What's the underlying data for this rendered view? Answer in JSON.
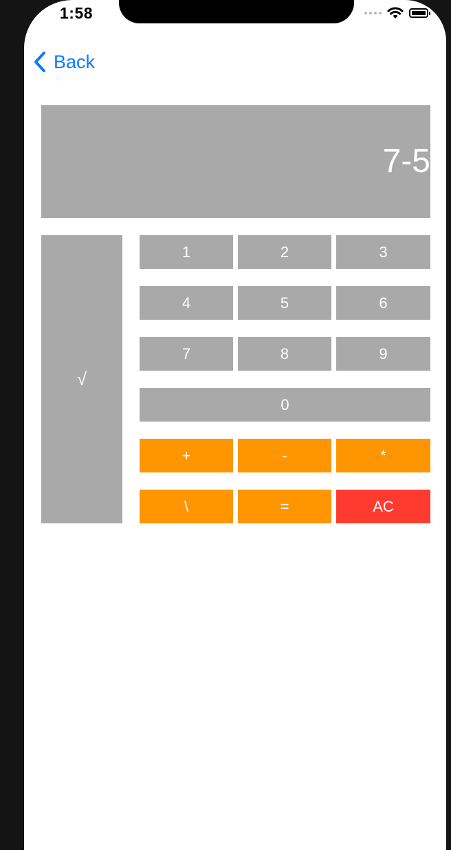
{
  "status_bar": {
    "time": "1:58"
  },
  "nav": {
    "back_label": "Back"
  },
  "display": {
    "expression": "7-5"
  },
  "keys": {
    "sqrt": "√",
    "one": "1",
    "two": "2",
    "three": "3",
    "four": "4",
    "five": "5",
    "six": "6",
    "seven": "7",
    "eight": "8",
    "nine": "9",
    "zero": "0",
    "plus": "+",
    "minus": "-",
    "multiply": "*",
    "divide": "\\",
    "equals": "=",
    "clear": "AC"
  },
  "colors": {
    "key_gray": "#a9a9a9",
    "operator_orange": "#ff9500",
    "clear_red": "#ff3b30",
    "link_blue": "#0a7aff"
  },
  "icons": {
    "back": "chevron-left-icon",
    "wifi": "wifi-icon",
    "battery": "battery-icon",
    "signal": "signal-icon"
  }
}
